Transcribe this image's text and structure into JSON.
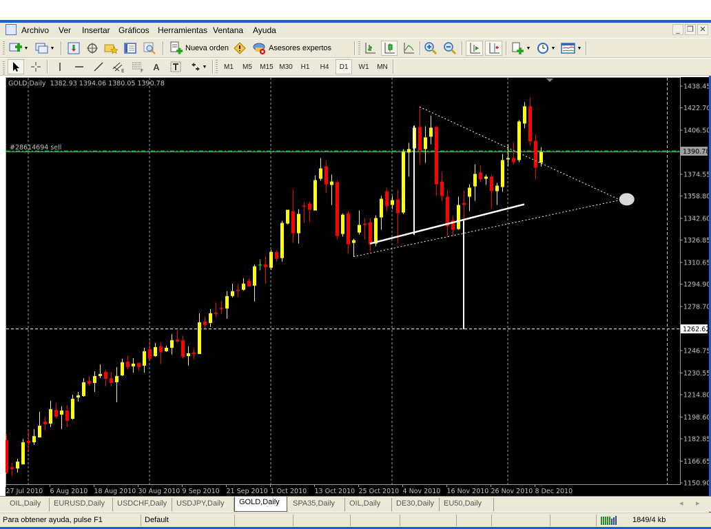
{
  "menu": {
    "items": [
      "Archivo",
      "Ver",
      "Insertar",
      "Gráficos",
      "Herramientas",
      "Ventana",
      "Ayuda"
    ],
    "window_controls": {
      "minimize": "_",
      "restore": "❐",
      "close": "✕"
    }
  },
  "toolbar1": {
    "new_order_label": "Nueva orden",
    "experts_label": "Asesores expertos",
    "icons": [
      "new-chart-icon",
      "profiles-icon",
      "market-watch-icon",
      "data-window-icon",
      "navigator-icon",
      "terminal-icon",
      "strategy-tester-icon",
      "new-order-icon",
      "metaeditor-icon",
      "experts-icon",
      "bar-chart-icon",
      "candlestick-icon",
      "line-chart-icon",
      "zoom-in-icon",
      "zoom-out-icon",
      "auto-scroll-icon",
      "chart-shift-icon",
      "templates-icon",
      "periods-icon",
      "indicators-icon"
    ]
  },
  "toolbar2": {
    "tools": [
      "cursor-icon",
      "crosshair-icon",
      "vertical-line-icon",
      "horizontal-line-icon",
      "trendline-icon",
      "equidistant-channel-icon",
      "fibonacci-icon",
      "text-icon",
      "text-label-icon",
      "arrows-icon"
    ],
    "text_tool": "A",
    "timeframes": [
      "M1",
      "M5",
      "M15",
      "M30",
      "H1",
      "H4",
      "D1",
      "W1",
      "MN"
    ],
    "active_timeframe": "D1"
  },
  "chart": {
    "header": "GOLD,Daily  1382.93 1394.06 1380.05 1390.78",
    "order_label": "#28614694 sell",
    "current_price_label": "1390.78",
    "crosshair_price_label": "1262.62"
  },
  "chart_data": {
    "type": "candlestick",
    "symbol": "GOLD",
    "timeframe": "Daily",
    "ylim": [
      1150.9,
      1438.45
    ],
    "y_ticks": [
      "1438.45",
      "1422.70",
      "1406.50",
      "1374.55",
      "1358.80",
      "1342.60",
      "1326.85",
      "1310.65",
      "1294.90",
      "1278.70",
      "1246.75",
      "1230.55",
      "1214.80",
      "1198.60",
      "1182.85",
      "1166.65",
      "1150.90"
    ],
    "y_tick_values": [
      1438.45,
      1422.7,
      1406.5,
      1374.55,
      1358.8,
      1342.6,
      1326.85,
      1310.65,
      1294.9,
      1278.7,
      1246.75,
      1230.55,
      1214.8,
      1198.6,
      1182.85,
      1166.65,
      1150.9
    ],
    "x_labels": [
      "27 Jul 2010",
      "6 Aug 2010",
      "18 Aug 2010",
      "30 Aug 2010",
      "9 Sep 2010",
      "21 Sep 2010",
      "1 Oct 2010",
      "13 Oct 2010",
      "25 Oct 2010",
      "4 Nov 2010",
      "16 Nov 2010",
      "26 Nov 2010",
      "8 Dec 2010"
    ],
    "x_label_every_bars": 8,
    "grid_bars": [
      4,
      26,
      48,
      70,
      91
    ],
    "colors": {
      "bull": "#ffff00",
      "bear": "#ff0000",
      "doji": "#00ff00",
      "order_line": "#00c000",
      "background": "#000000"
    },
    "ohlc": [
      [
        1181.9,
        1186.3,
        1157.4,
        1158.4
      ],
      [
        1162.3,
        1165.3,
        1155.8,
        1160.8
      ],
      [
        1161.3,
        1168.3,
        1158.3,
        1166.3
      ],
      [
        1164.3,
        1182.8,
        1164.3,
        1180.3
      ],
      [
        1181.3,
        1189.8,
        1173.3,
        1179.8
      ],
      [
        1180.3,
        1189.8,
        1178.3,
        1184.8
      ],
      [
        1183.8,
        1202.3,
        1183.8,
        1192.3
      ],
      [
        1195.3,
        1198.8,
        1188.8,
        1193.3
      ],
      [
        1193.8,
        1210.3,
        1191.3,
        1204.3
      ],
      [
        1203.8,
        1208.8,
        1197.8,
        1198.8
      ],
      [
        1200.3,
        1206.3,
        1189.8,
        1203.3
      ],
      [
        1203.3,
        1207.3,
        1191.3,
        1195.8
      ],
      [
        1197.3,
        1214.8,
        1196.8,
        1211.8
      ],
      [
        1212.8,
        1216.8,
        1209.8,
        1214.3
      ],
      [
        1213.8,
        1226.8,
        1213.3,
        1223.8
      ],
      [
        1224.8,
        1228.3,
        1221.3,
        1222.8
      ],
      [
        1223.3,
        1231.8,
        1216.8,
        1228.3
      ],
      [
        1228.3,
        1236.8,
        1226.8,
        1229.8
      ],
      [
        1231.3,
        1232.8,
        1220.8,
        1226.3
      ],
      [
        1226.8,
        1231.3,
        1220.8,
        1223.3
      ],
      [
        1223.8,
        1234.8,
        1209.3,
        1228.3
      ],
      [
        1228.8,
        1240.8,
        1228.3,
        1238.3
      ],
      [
        1238.8,
        1243.3,
        1233.3,
        1234.8
      ],
      [
        1235.3,
        1241.3,
        1230.8,
        1237.3
      ],
      [
        1237.8,
        1237.8,
        1232.3,
        1234.8
      ],
      [
        1235.8,
        1248.8,
        1230.8,
        1246.3
      ],
      [
        1247.8,
        1254.3,
        1240.8,
        1240.8
      ],
      [
        1242.8,
        1252.3,
        1242.3,
        1249.3
      ],
      [
        1249.8,
        1252.8,
        1236.8,
        1245.8
      ],
      [
        1246.3,
        1250.3,
        1245.8,
        1248.8
      ],
      [
        1248.8,
        1258.8,
        1243.8,
        1254.3
      ],
      [
        1254.8,
        1261.8,
        1252.3,
        1253.3
      ],
      [
        1254.3,
        1257.8,
        1241.3,
        1242.3
      ],
      [
        1242.8,
        1249.8,
        1235.8,
        1244.8
      ],
      [
        1245.3,
        1248.3,
        1240.3,
        1244.3
      ],
      [
        1244.3,
        1273.8,
        1244.3,
        1267.3
      ],
      [
        1267.8,
        1271.3,
        1262.3,
        1265.3
      ],
      [
        1266.8,
        1276.8,
        1263.8,
        1273.8
      ],
      [
        1274.3,
        1281.8,
        1270.8,
        1273.3
      ],
      [
        1277.8,
        1282.8,
        1273.3,
        1276.8
      ],
      [
        1277.3,
        1289.8,
        1269.8,
        1286.3
      ],
      [
        1286.3,
        1295.3,
        1285.3,
        1289.8
      ],
      [
        1290.8,
        1295.3,
        1285.8,
        1290.3
      ],
      [
        1290.8,
        1299.3,
        1290.3,
        1295.3
      ],
      [
        1297.3,
        1299.3,
        1292.8,
        1293.3
      ],
      [
        1293.8,
        1309.3,
        1282.3,
        1307.8
      ],
      [
        1308.8,
        1312.8,
        1304.8,
        1308.8
      ],
      [
        1309.3,
        1315.3,
        1295.3,
        1307.3
      ],
      [
        1306.8,
        1319.8,
        1305.3,
        1318.3
      ],
      [
        1318.3,
        1319.3,
        1311.3,
        1313.3
      ],
      [
        1313.8,
        1340.8,
        1311.3,
        1339.3
      ],
      [
        1338.8,
        1348.8,
        1338.3,
        1348.8
      ],
      [
        1347.8,
        1363.8,
        1324.8,
        1331.8
      ],
      [
        1331.8,
        1349.3,
        1324.3,
        1345.8
      ],
      [
        1351.8,
        1354.3,
        1339.3,
        1351.3
      ],
      [
        1353.3,
        1354.8,
        1339.8,
        1348.8
      ],
      [
        1348.3,
        1373.8,
        1348.3,
        1370.3
      ],
      [
        1371.3,
        1386.3,
        1369.8,
        1378.8
      ],
      [
        1380.3,
        1384.3,
        1361.3,
        1367.3
      ],
      [
        1366.8,
        1374.3,
        1352.3,
        1369.3
      ],
      [
        1368.8,
        1370.3,
        1327.3,
        1329.8
      ],
      [
        1331.3,
        1346.3,
        1329.3,
        1345.3
      ],
      [
        1346.3,
        1347.8,
        1316.8,
        1323.8
      ],
      [
        1324.8,
        1327.8,
        1314.8,
        1326.8
      ],
      [
        1332.3,
        1348.3,
        1330.8,
        1337.8
      ],
      [
        1338.8,
        1342.8,
        1327.3,
        1337.8
      ],
      [
        1339.8,
        1342.8,
        1318.3,
        1323.8
      ],
      [
        1324.3,
        1344.8,
        1322.3,
        1342.8
      ],
      [
        1343.3,
        1358.8,
        1334.3,
        1356.8
      ],
      [
        1362.3,
        1364.8,
        1347.8,
        1351.3
      ],
      [
        1352.3,
        1358.8,
        1349.3,
        1355.8
      ],
      [
        1356.3,
        1363.3,
        1324.3,
        1346.3
      ],
      [
        1346.8,
        1392.8,
        1345.8,
        1390.8
      ],
      [
        1390.3,
        1397.3,
        1372.8,
        1392.8
      ],
      [
        1393.3,
        1409.8,
        1390.3,
        1408.3
      ],
      [
        1408.8,
        1423.8,
        1381.8,
        1391.8
      ],
      [
        1392.8,
        1409.3,
        1382.8,
        1401.3
      ],
      [
        1401.8,
        1416.8,
        1396.3,
        1408.3
      ],
      [
        1408.8,
        1409.8,
        1358.8,
        1367.3
      ],
      [
        1369.3,
        1376.3,
        1354.8,
        1358.8
      ],
      [
        1358.3,
        1363.8,
        1328.8,
        1336.8
      ],
      [
        1341.3,
        1344.3,
        1329.8,
        1334.3
      ],
      [
        1334.8,
        1358.3,
        1334.3,
        1352.3
      ],
      [
        1353.8,
        1362.8,
        1340.8,
        1352.3
      ],
      [
        1358.3,
        1367.3,
        1347.8,
        1364.8
      ],
      [
        1365.8,
        1381.8,
        1355.3,
        1374.8
      ],
      [
        1375.8,
        1380.8,
        1368.8,
        1370.8
      ],
      [
        1371.3,
        1374.3,
        1366.8,
        1372.8
      ],
      [
        1372.8,
        1374.3,
        1349.8,
        1362.3
      ],
      [
        1362.3,
        1368.3,
        1352.3,
        1366.3
      ],
      [
        1365.3,
        1389.3,
        1361.8,
        1384.8
      ],
      [
        1385.3,
        1396.3,
        1380.3,
        1386.3
      ],
      [
        1386.3,
        1397.8,
        1381.8,
        1383.3
      ],
      [
        1384.8,
        1413.8,
        1383.3,
        1412.8
      ],
      [
        1411.3,
        1426.8,
        1407.8,
        1423.8
      ],
      [
        1423.8,
        1430.3,
        1395.3,
        1398.3
      ],
      [
        1398.8,
        1403.8,
        1370.8,
        1379.3
      ],
      [
        1382.93,
        1394.06,
        1380.05,
        1390.78
      ]
    ],
    "order_line_price": 1390.78,
    "crosshair": {
      "bar": 120,
      "price": 1262.62
    },
    "drawings": [
      {
        "name": "triangle-upper-line",
        "style": "dotted",
        "bar1": 75,
        "price1": 1423.4,
        "bar2": 111.4,
        "price2": 1355.9
      },
      {
        "name": "triangle-lower-line",
        "style": "dotted",
        "bar1": 63,
        "price1": 1314.8,
        "bar2": 111.4,
        "price2": 1355.9
      },
      {
        "name": "support-trendline",
        "style": "solid",
        "bar1": 66,
        "price1": 1324.3,
        "bar2": 94,
        "price2": 1352.8
      },
      {
        "name": "vertical-segment-1",
        "style": "solid",
        "bar1": 74,
        "price1": 1409.8,
        "bar2": 74,
        "price2": 1330.8
      },
      {
        "name": "vertical-segment-2",
        "style": "solid",
        "bar1": 83,
        "price1": 1340.8,
        "bar2": 83,
        "price2": 1262.3
      }
    ],
    "apex_marker": {
      "bar": 112.6,
      "price": 1356.4
    }
  },
  "tabs": [
    {
      "label": "OIL,Daily"
    },
    {
      "label": "EURUSD,Daily"
    },
    {
      "label": "USDCHF,Daily"
    },
    {
      "label": "USDJPY,Daily"
    },
    {
      "label": "GOLD,Daily",
      "active": true
    },
    {
      "label": "SPA35,Daily"
    },
    {
      "label": "OIL,Daily"
    },
    {
      "label": "DE30,Daily"
    },
    {
      "label": "EU50,Daily"
    }
  ],
  "tab_scroll": {
    "left": "◂",
    "right": "▸"
  },
  "status": {
    "help": "Para obtener ayuda, pulse F1",
    "profile": "Default",
    "traffic": "1849/4 kb"
  }
}
